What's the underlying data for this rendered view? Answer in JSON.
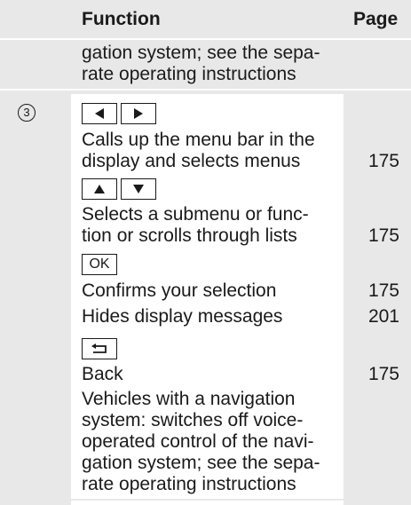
{
  "header": {
    "function_label": "Function",
    "page_label": "Page"
  },
  "continued": {
    "line1": "gation system; see the sepa-",
    "line2": "rate operating instructions"
  },
  "row": {
    "marker": "3",
    "items": [
      {
        "keys": [
          "◀",
          "▶"
        ],
        "lines": [
          "Calls up the menu bar in the",
          "display and selects menus"
        ],
        "page": "175"
      },
      {
        "keys": [
          "▲",
          "▼"
        ],
        "lines": [
          "Selects a submenu or func-",
          "tion or scrolls through lists"
        ],
        "page": "175"
      },
      {
        "keys": [
          "OK"
        ],
        "lines": [
          "Confirms your selection"
        ],
        "page": "175"
      },
      {
        "lines": [
          "Hides display messages"
        ],
        "page": "201"
      },
      {
        "keys": [
          "back"
        ],
        "lines": [
          "Back"
        ],
        "page": "175"
      },
      {
        "lines": [
          "Vehicles with a navigation",
          "system: switches off voice-",
          "operated control of the navi-",
          "gation system; see the sepa-",
          "rate operating instructions"
        ]
      }
    ]
  }
}
